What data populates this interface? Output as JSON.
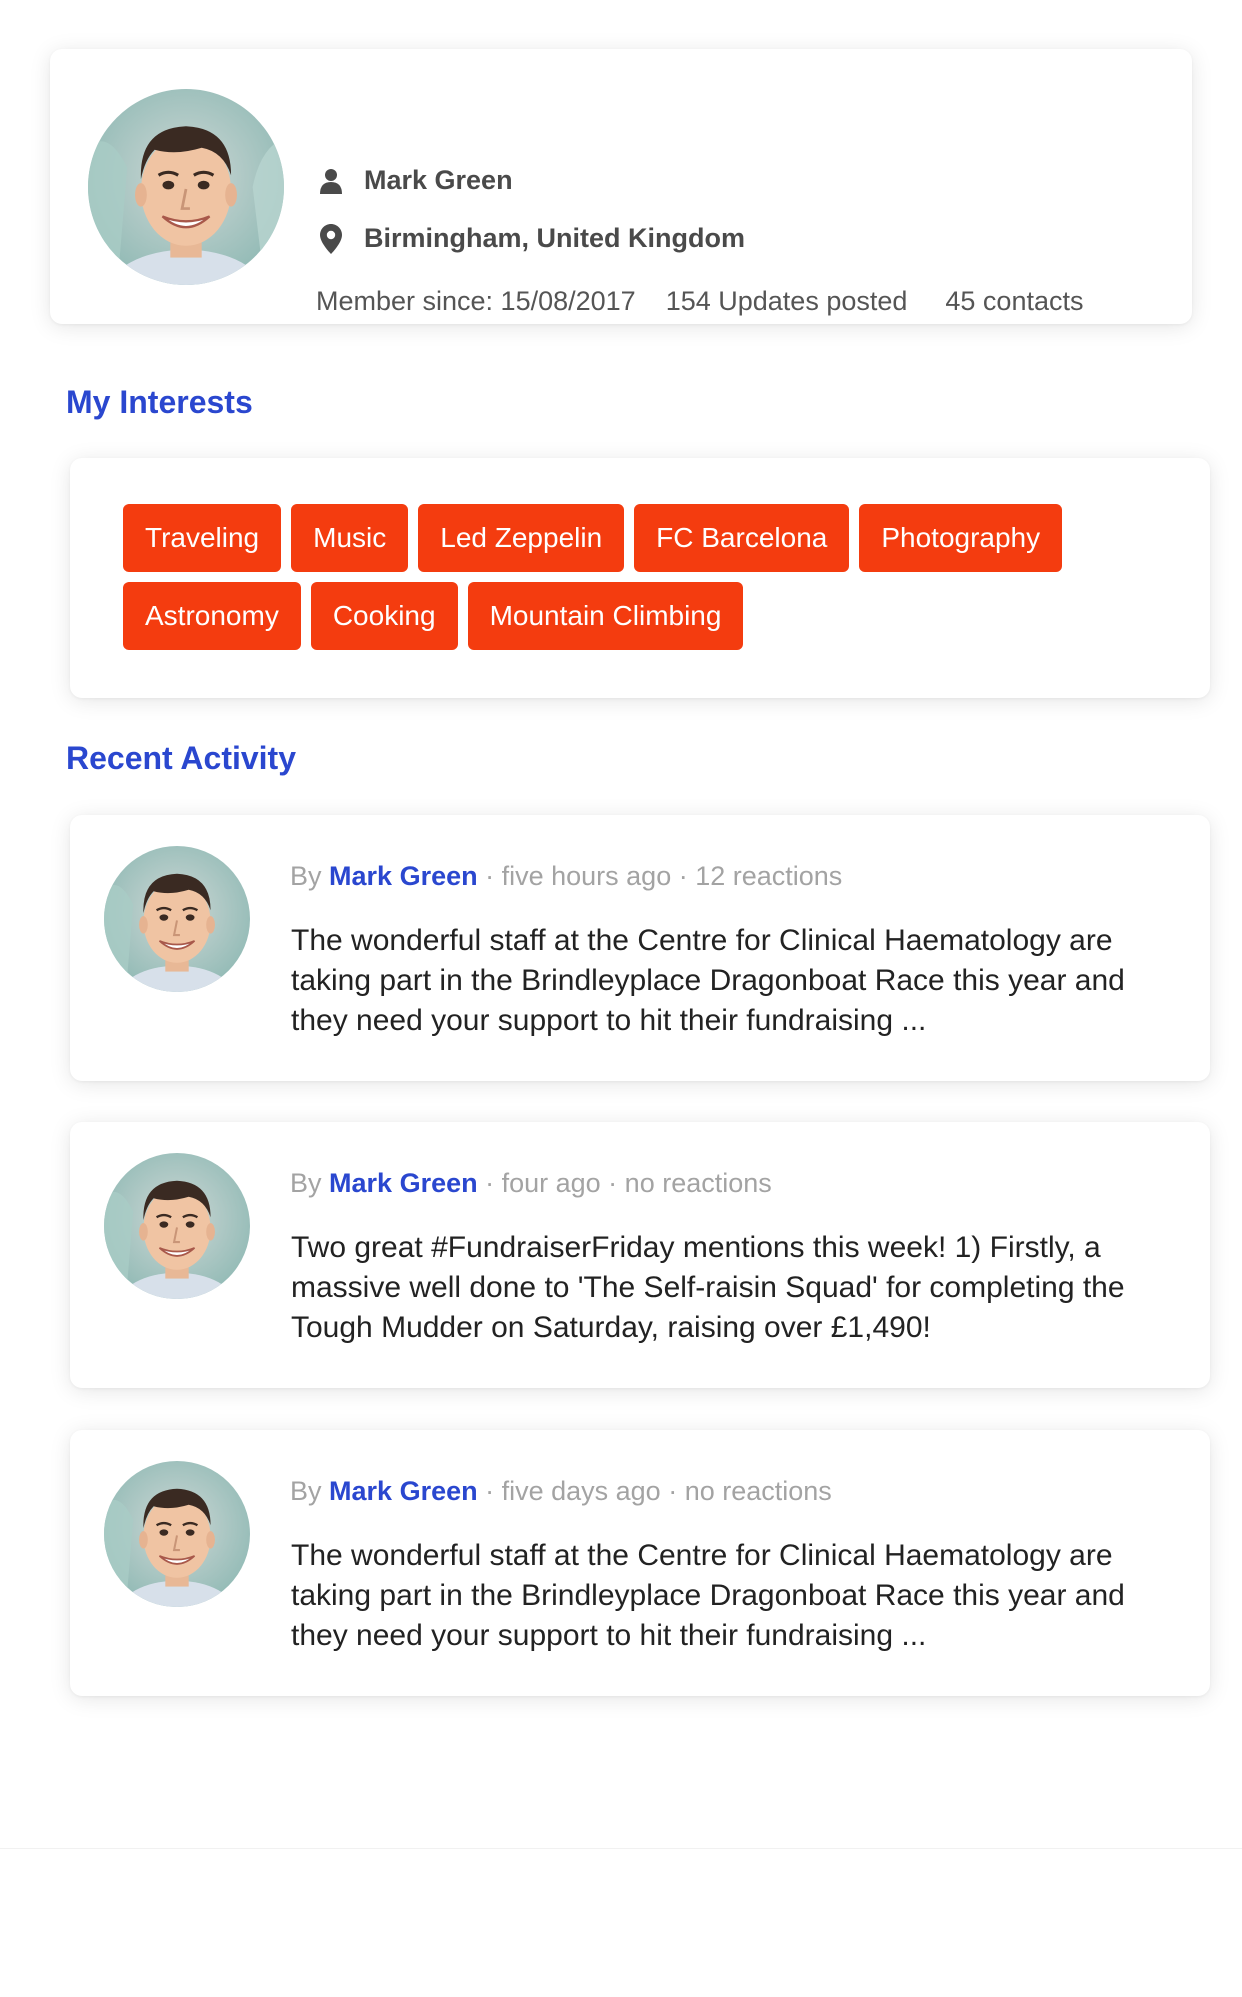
{
  "profile": {
    "name": "Mark Green",
    "location": "Birmingham, United Kingdom",
    "member_since": "Member since: 15/08/2017",
    "updates": "154 Updates posted",
    "contacts": "45 contacts"
  },
  "interests": {
    "heading": "My Interests",
    "tags": [
      "Traveling",
      "Music",
      "Led Zeppelin",
      "FC Barcelona",
      "Photography",
      "Astronomy",
      "Cooking",
      "Mountain Climbing"
    ]
  },
  "activity": {
    "heading": "Recent Activity",
    "items": [
      {
        "by": "By",
        "author": "Mark Green",
        "details": " · five hours ago · 12 reactions",
        "text": "The wonderful staff at the Centre for Clinical Haematology are taking part in the Brindleyplace Dragonboat Race this year and they need your support to hit their fundraising ..."
      },
      {
        "by": "By",
        "author": "Mark Green",
        "details": " · four ago · no reactions",
        "text": "Two great #FundraiserFriday mentions this week! 1) Firstly, a massive well done to 'The Self-raisin Squad' for completing the Tough Mudder on Saturday, raising over £1,490!"
      },
      {
        "by": "By",
        "author": "Mark Green",
        "details": " · five days ago · no reactions",
        "text": "The wonderful staff at the Centre for Clinical Haematology are taking part in the Brindleyplace Dragonboat Race this year and they need your support to hit their fundraising ..."
      }
    ]
  },
  "icons": {
    "name": "user-icon",
    "location": "map-pin-icon"
  },
  "colors": {
    "accent_blue": "#2a47cf",
    "tag_orange": "#f43c0f",
    "meta_gray": "#a3a3a3"
  }
}
